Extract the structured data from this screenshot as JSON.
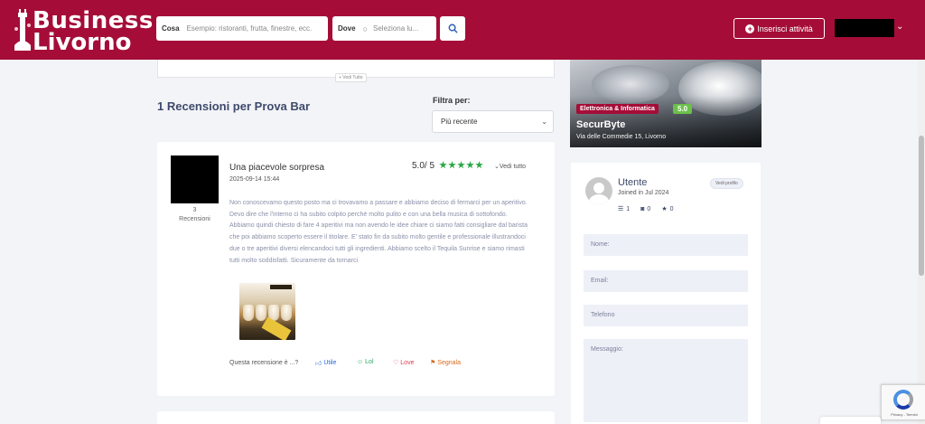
{
  "header": {
    "logo_line1": "Business",
    "logo_line2": "Livorno",
    "search_what_label": "Cosa",
    "search_what_placeholder": "Esempio: ristoranti, frutta, finestre, ecc.",
    "search_where_label": "Dove",
    "search_where_placeholder": "Seleziona lu...",
    "add_business_label": "Inserisci attività",
    "colors": {
      "brand": "#a50d38"
    }
  },
  "top_card": {
    "vedi_tutto": "+ Vedi Tutto"
  },
  "reviews": {
    "title": "1 Recensioni per Prova Bar",
    "filter_label": "Filtra per:",
    "filter_selected": "Più recente",
    "items": [
      {
        "reviewer_count_number": "3",
        "reviewer_count_label": "Recensioni",
        "title": "Una piacevole sorpresa",
        "date": "2025-09-14 15:44",
        "score": "5.0/ 5",
        "rating_stars": 5,
        "vedi_tutto": "Vedi tutto",
        "text": "Non conoscevamo questo posto ma ci trovavamo a passare e abbiamo deciso di fermarci per un aperitivo. Devo dire che l'interno ci ha subito colpito perché molto pulito e con una bella musica di sottofondo. Abbiamo quindi chiesto di fare 4 aperitivi ma non avendo le idee chiare ci siamo fatti consigliare dal barista che poi abbiamo scoperto essere il titolare. E' stato fin da subito molto gentile e professionale illustrandoci due o tre aperitivi diversi elencandoci tutti gli ingredienti. Abbiamo scelto il Tequila Sunrise e siamo rimasti tutti molto soddisfatti. Sicuramente da tornarci",
        "question": "Questa recensione è ...?",
        "actions": {
          "utile": "Utile",
          "lol": "Lol",
          "love": "Love",
          "segnala": "Segnala"
        }
      }
    ]
  },
  "business_card": {
    "category": "Elettronica & Informatica",
    "rating": "5.0",
    "name": "SecurByte",
    "address": "Via delle Commedie 15, Livorno"
  },
  "user_card": {
    "name": "Utente",
    "joined": "Joined in Jul 2024",
    "profile_button": "Vedi profilo",
    "stats": {
      "reviews": "1",
      "photos": "0",
      "favorites": "0"
    }
  },
  "contact_form": {
    "name_placeholder": "Nome:",
    "email_placeholder": "Email:",
    "phone_placeholder": "Telefono",
    "message_placeholder": "Messaggio:"
  },
  "recaptcha": {
    "text": "Privacy - Termini"
  }
}
